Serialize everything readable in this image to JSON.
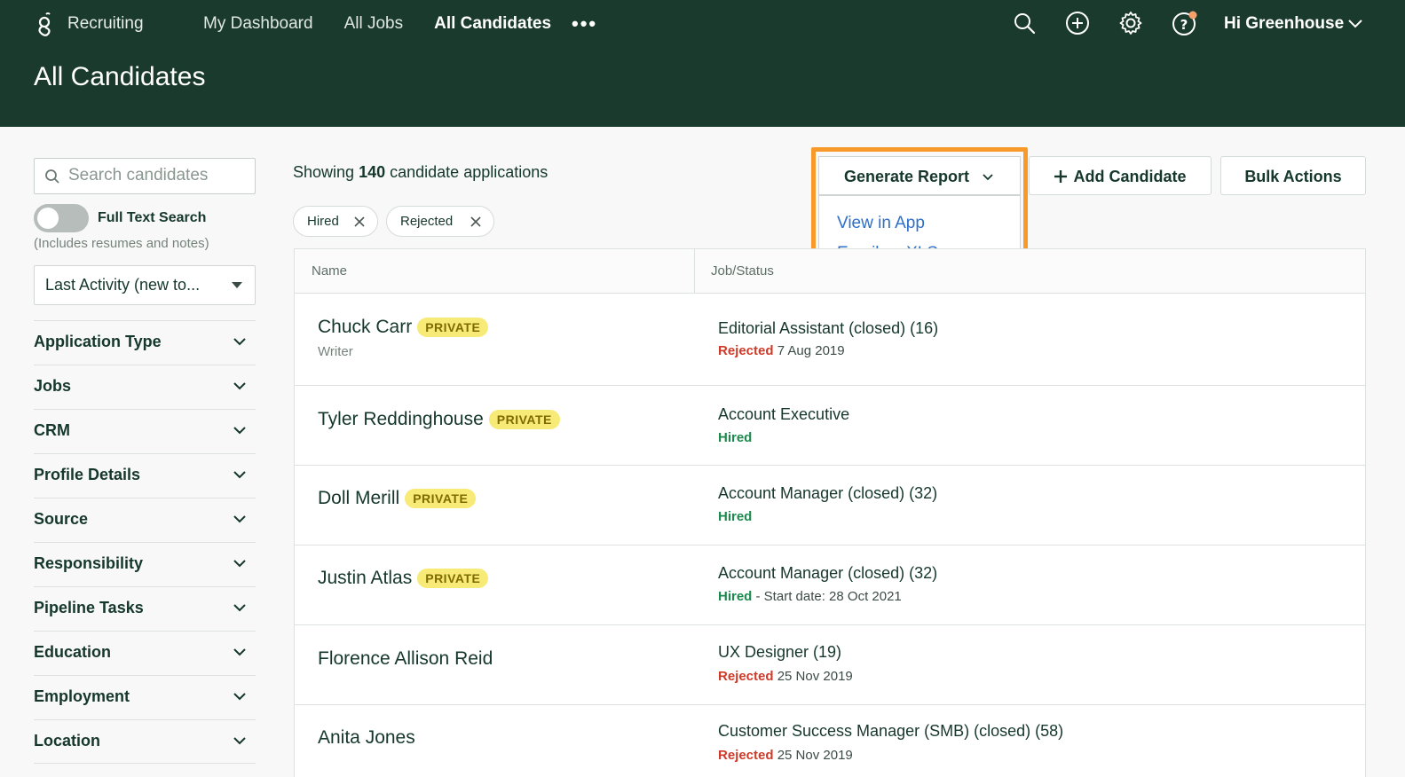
{
  "header": {
    "brand": "Recruiting",
    "nav": [
      "My Dashboard",
      "All Jobs",
      "All Candidates"
    ],
    "more": "•••",
    "greeting": "Hi Greenhouse",
    "page_title": "All Candidates"
  },
  "sidebar": {
    "search_placeholder": "Search candidates",
    "full_text_search_label": "Full Text Search",
    "full_text_search_note": "(Includes resumes and notes)",
    "sort_value": "Last Activity (new to...",
    "filters": [
      "Application Type",
      "Jobs",
      "CRM",
      "Profile Details",
      "Source",
      "Responsibility",
      "Pipeline Tasks",
      "Education",
      "Employment",
      "Location"
    ]
  },
  "main": {
    "showing_prefix": "Showing",
    "showing_count": "140",
    "showing_suffix": "candidate applications",
    "chips": [
      "Hired",
      "Rejected"
    ],
    "generate_report": "Generate Report",
    "report_menu": [
      "View in App",
      "Email as XLS"
    ],
    "add_candidate": "Add Candidate",
    "bulk_actions": "Bulk Actions",
    "columns": [
      "Name",
      "Job/Status"
    ],
    "private_label": "PRIVATE",
    "rows": [
      {
        "name": "Chuck Carr",
        "private": true,
        "subtitle": "Writer",
        "job": "Editorial Assistant (closed) (16)",
        "status": "Rejected",
        "status_detail": "7 Aug 2019"
      },
      {
        "name": "Tyler Reddinghouse",
        "private": true,
        "subtitle": "",
        "job": "Account Executive",
        "status": "Hired",
        "status_detail": ""
      },
      {
        "name": "Doll Merill",
        "private": true,
        "subtitle": "",
        "job": "Account Manager (closed) (32)",
        "status": "Hired",
        "status_detail": ""
      },
      {
        "name": "Justin Atlas",
        "private": true,
        "subtitle": "",
        "job": "Account Manager (closed) (32)",
        "status": "Hired",
        "status_detail": "- Start date: 28 Oct 2021"
      },
      {
        "name": "Florence Allison Reid",
        "private": false,
        "subtitle": "",
        "job": "UX Designer (19)",
        "status": "Rejected",
        "status_detail": "25 Nov 2019"
      },
      {
        "name": "Anita Jones",
        "private": false,
        "subtitle": "",
        "job": "Customer Success Manager (SMB) (closed) (58)",
        "status": "Rejected",
        "status_detail": "25 Nov 2019"
      }
    ]
  },
  "colors": {
    "header_bg": "#1b3a2e",
    "highlight": "#f79a2a",
    "link": "#2e6fc8",
    "rejected": "#d03a28",
    "hired": "#1a8a4d",
    "badge_bg": "#f7ea77"
  },
  "icons": [
    "greenhouse-logo-icon",
    "search-icon",
    "plus-circle-icon",
    "gear-icon",
    "help-icon",
    "chevron-down-icon",
    "close-icon",
    "plus-icon"
  ]
}
